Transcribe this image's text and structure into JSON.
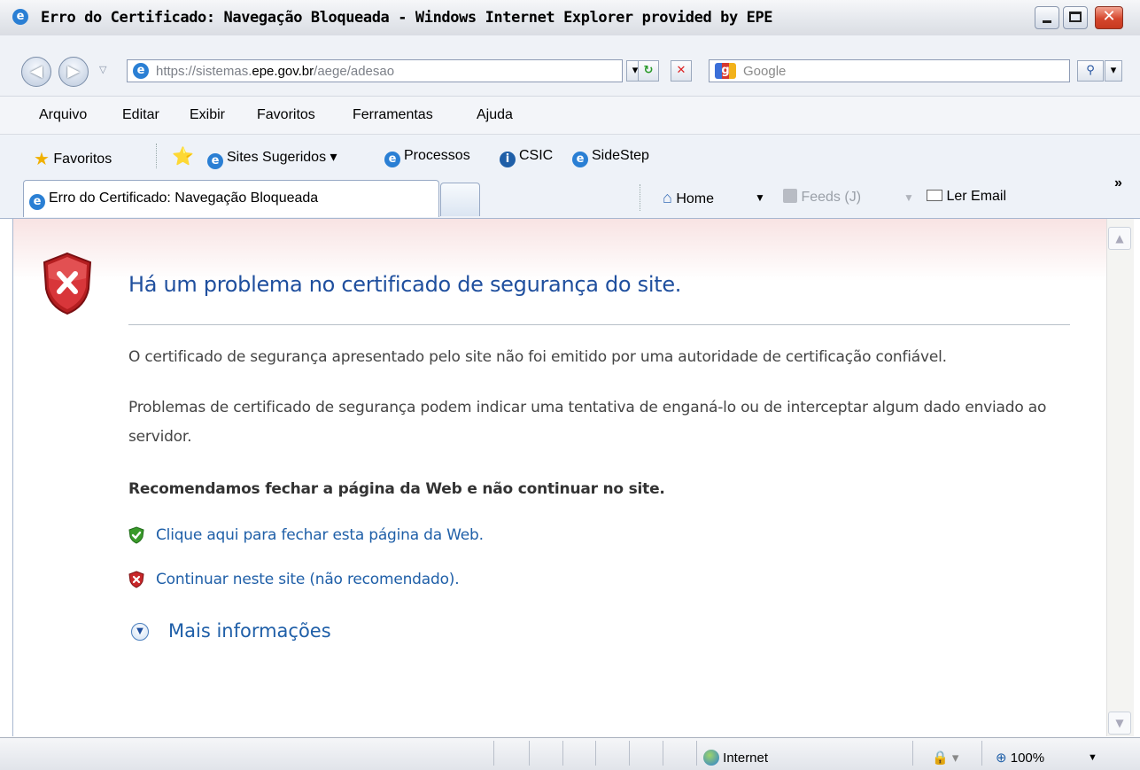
{
  "window": {
    "title": "Erro do Certificado: Navegação Bloqueada - Windows Internet Explorer provided by EPE"
  },
  "address_bar": {
    "url_prefix": "https://sistemas.",
    "url_domain": "epe.gov.br",
    "url_path": "/aege/adesao",
    "search_placeholder": "Google"
  },
  "menu": [
    "Arquivo",
    "Editar",
    "Exibir",
    "Favoritos",
    "Ferramentas",
    "Ajuda"
  ],
  "favorites_bar": {
    "favorites_label": "Favoritos",
    "items": [
      "Sites Sugeridos ▾",
      "Processos",
      "CSIC",
      "SideStep"
    ]
  },
  "tabs": {
    "active_label": "Erro do Certificado: Navegação Bloqueada"
  },
  "command_bar": {
    "home": "Home",
    "feeds": "Feeds (J)",
    "read_mail": "Ler Email",
    "chevron": "»"
  },
  "page": {
    "heading": "Há um problema no certificado de segurança do site.",
    "paragraph1": "O certificado de segurança apresentado pelo site não foi emitido por uma autoridade de certificação confiável.",
    "paragraph2": "Problemas de certificado de segurança podem indicar uma tentativa de enganá-lo ou de interceptar algum dado enviado ao servidor.",
    "recommendation": "Recomendamos fechar a página da Web e não continuar no site.",
    "close_link": "Clique aqui para fechar esta página da Web.",
    "continue_link": "Continuar neste site (não recomendado).",
    "more_info": "Mais informações"
  },
  "status_bar": {
    "zone": "Internet",
    "zoom": "100%"
  },
  "colors": {
    "heading_blue": "#1f4f9e",
    "link_blue": "#1f5fa8",
    "danger_red": "#c8282a",
    "safe_green": "#3a9a2a"
  },
  "icons": [
    "ie-icon",
    "back-icon",
    "forward-icon",
    "refresh-icon",
    "stop-icon",
    "google-icon",
    "search-icon",
    "star-icon",
    "add-favorites-icon",
    "info-icon",
    "home-icon",
    "feeds-icon",
    "mail-icon",
    "error-shield-icon",
    "green-shield-icon",
    "red-shield-icon",
    "expand-icon",
    "globe-icon",
    "zoom-icon"
  ]
}
